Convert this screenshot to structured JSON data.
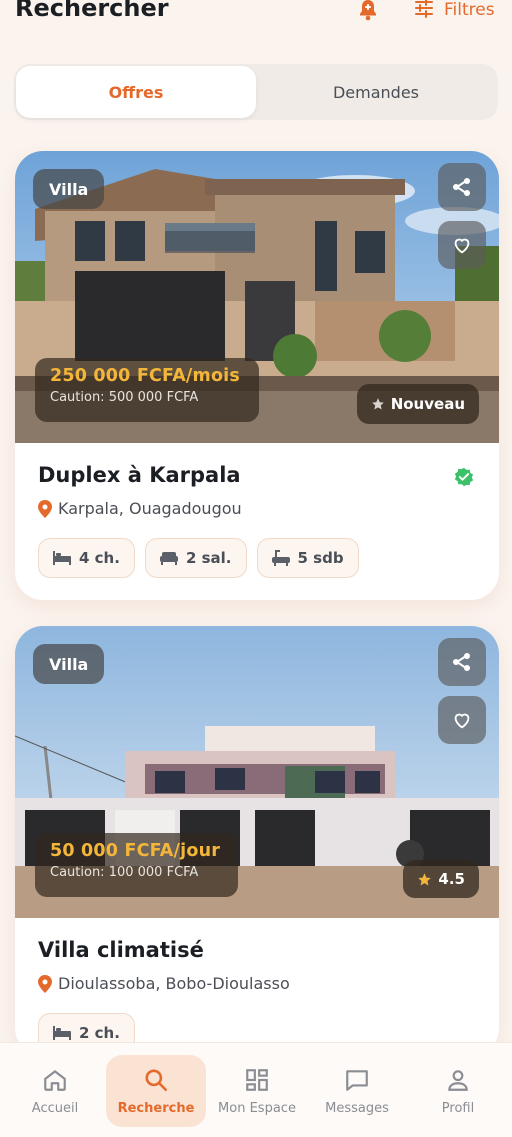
{
  "header": {
    "title": "Rechercher",
    "filters_label": "Filtres",
    "icons": {
      "bell": "notification-bell-icon",
      "filters": "sliders-icon"
    }
  },
  "tabs": [
    {
      "label": "Offres",
      "active": true
    },
    {
      "label": "Demandes",
      "active": false
    }
  ],
  "listings": [
    {
      "type": "Villa",
      "price": "250 000 FCFA/mois",
      "deposit": "Caution: 500 000 FCFA",
      "badge": "Nouveau",
      "badge_icon": "star-icon",
      "title": "Duplex à Karpala",
      "verified": true,
      "location": "Karpala, Ouagadougou",
      "features": [
        "4 ch.",
        "2 sal.",
        "5 sdb"
      ]
    },
    {
      "type": "Villa",
      "price": "50 000 FCFA/jour",
      "deposit": "Caution: 100 000 FCFA",
      "badge": "4.5",
      "badge_icon": "star-icon",
      "title": "Villa climatisé",
      "verified": false,
      "location": "Dioulassoba, Bobo-Dioulasso",
      "features": [
        "2 ch."
      ]
    }
  ],
  "bottom_nav": [
    {
      "label": "Accueil",
      "icon": "home-icon",
      "active": false
    },
    {
      "label": "Recherche",
      "icon": "search-icon",
      "active": true
    },
    {
      "label": "Mon Espace",
      "icon": "grid-icon",
      "active": false
    },
    {
      "label": "Messages",
      "icon": "chat-icon",
      "active": false
    },
    {
      "label": "Profil",
      "icon": "user-icon",
      "active": false
    }
  ],
  "colors": {
    "accent": "#e46a2c",
    "price": "#f3b63a",
    "verified": "#3cc06a",
    "background": "#fbf3ee"
  }
}
